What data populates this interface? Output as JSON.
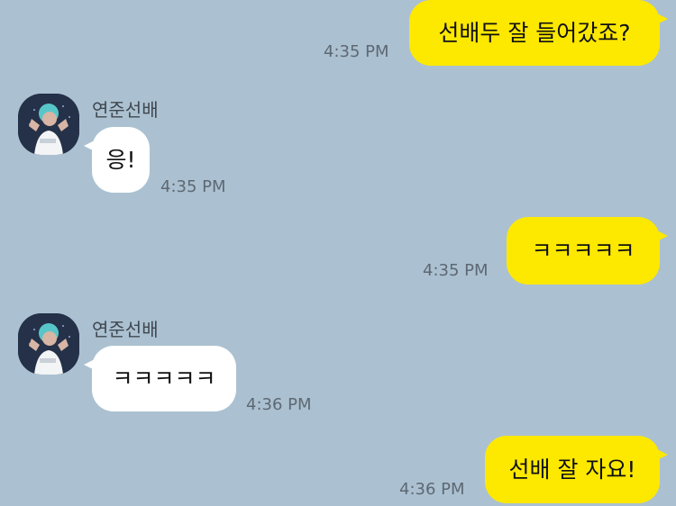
{
  "messages": [
    {
      "text": "선배두 잘 들어갔죠?",
      "time": "4:35 PM",
      "from": "me"
    },
    {
      "text": "응!",
      "time": "4:35 PM",
      "from": "other",
      "sender": "연준선배"
    },
    {
      "text": "ㅋㅋㅋㅋㅋ",
      "time": "4:35 PM",
      "from": "me"
    },
    {
      "text": "ㅋㅋㅋㅋㅋ",
      "time": "4:36 PM",
      "from": "other",
      "sender": "연준선배"
    },
    {
      "text": "선배 잘 자요!",
      "time": "4:36 PM",
      "from": "me"
    }
  ],
  "colors": {
    "background": "#abc1d1",
    "my_bubble": "#fde800",
    "other_bubble": "#ffffff"
  },
  "icons": {
    "avatar": "profile-photo"
  }
}
